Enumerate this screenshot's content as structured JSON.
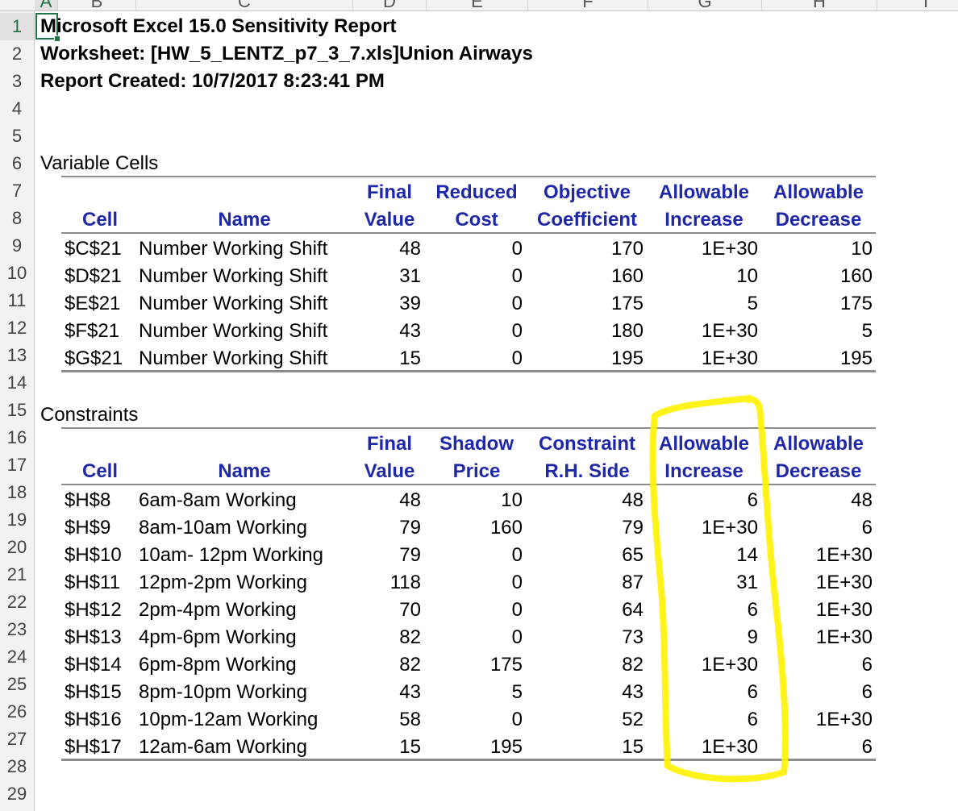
{
  "column_headers": [
    "A",
    "B",
    "C",
    "D",
    "E",
    "F",
    "G",
    "H",
    "I"
  ],
  "row_numbers": [
    "1",
    "2",
    "3",
    "4",
    "5",
    "6",
    "7",
    "8",
    "9",
    "10",
    "11",
    "12",
    "13",
    "14",
    "15",
    "16",
    "17",
    "18",
    "19",
    "20",
    "21",
    "22",
    "23",
    "24",
    "25",
    "26",
    "27",
    "28",
    "29"
  ],
  "report": {
    "title": "Microsoft Excel 15.0 Sensitivity Report",
    "worksheet": "Worksheet: [HW_5_LENTZ_p7_3_7.xls]Union Airways",
    "created": "Report Created: 10/7/2017 8:23:41 PM"
  },
  "variable_cells": {
    "section_title": "Variable Cells",
    "headers": {
      "row1": [
        "",
        "",
        "Final",
        "Reduced",
        "Objective",
        "Allowable",
        "Allowable"
      ],
      "row2": [
        "Cell",
        "Name",
        "Value",
        "Cost",
        "Coefficient",
        "Increase",
        "Decrease"
      ]
    },
    "rows": [
      [
        "$C$21",
        "Number Working Shift",
        "48",
        "0",
        "170",
        "1E+30",
        "10"
      ],
      [
        "$D$21",
        "Number Working Shift",
        "31",
        "0",
        "160",
        "10",
        "160"
      ],
      [
        "$E$21",
        "Number Working Shift",
        "39",
        "0",
        "175",
        "5",
        "175"
      ],
      [
        "$F$21",
        "Number Working Shift",
        "43",
        "0",
        "180",
        "1E+30",
        "5"
      ],
      [
        "$G$21",
        "Number Working Shift",
        "15",
        "0",
        "195",
        "1E+30",
        "195"
      ]
    ]
  },
  "constraints": {
    "section_title": "Constraints",
    "headers": {
      "row1": [
        "",
        "",
        "Final",
        "Shadow",
        "Constraint",
        "Allowable",
        "Allowable"
      ],
      "row2": [
        "Cell",
        "Name",
        "Value",
        "Price",
        "R.H. Side",
        "Increase",
        "Decrease"
      ]
    },
    "rows": [
      [
        "$H$8",
        "6am-8am Working",
        "48",
        "10",
        "48",
        "6",
        "48"
      ],
      [
        "$H$9",
        "8am-10am Working",
        "79",
        "160",
        "79",
        "1E+30",
        "6"
      ],
      [
        "$H$10",
        "10am- 12pm Working",
        "79",
        "0",
        "65",
        "14",
        "1E+30"
      ],
      [
        "$H$11",
        "12pm-2pm Working",
        "118",
        "0",
        "87",
        "31",
        "1E+30"
      ],
      [
        "$H$12",
        "2pm-4pm Working",
        "70",
        "0",
        "64",
        "6",
        "1E+30"
      ],
      [
        "$H$13",
        "4pm-6pm Working",
        "82",
        "0",
        "73",
        "9",
        "1E+30"
      ],
      [
        "$H$14",
        "6pm-8pm Working",
        "82",
        "175",
        "82",
        "1E+30",
        "6"
      ],
      [
        "$H$15",
        "8pm-10pm Working",
        "43",
        "5",
        "43",
        "6",
        "6"
      ],
      [
        "$H$16",
        "10pm-12am Working",
        "58",
        "0",
        "52",
        "6",
        "1E+30"
      ],
      [
        "$H$17",
        "12am-6am Working",
        "15",
        "195",
        "15",
        "1E+30",
        "6"
      ]
    ]
  },
  "colors": {
    "header_blue": "#1f28a8",
    "highlight": "#fff200",
    "excel_green": "#217346"
  }
}
